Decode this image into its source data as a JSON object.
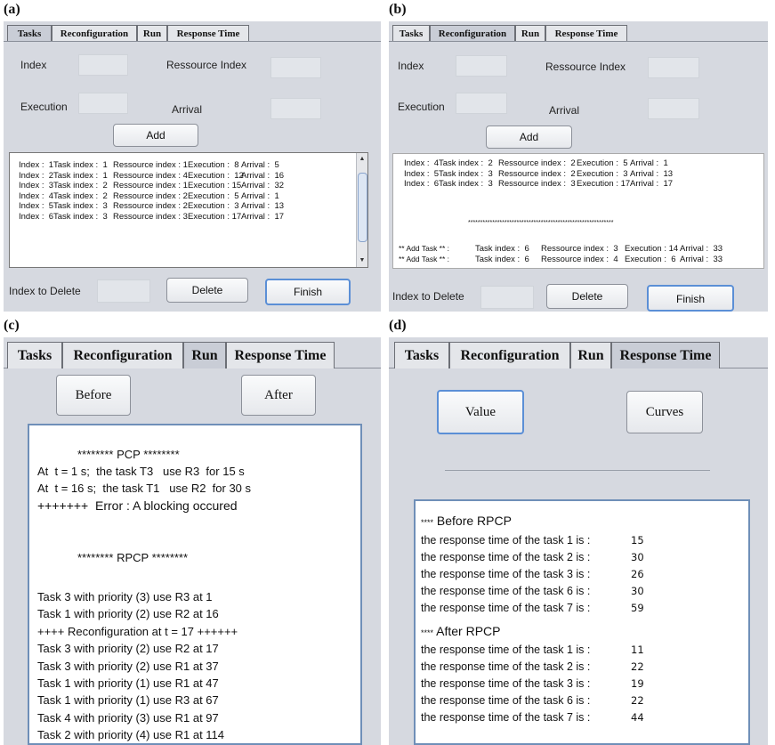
{
  "labels": {
    "a": "(a)",
    "b": "(b)",
    "c": "(c)",
    "d": "(d)"
  },
  "tabs": [
    "Tasks",
    "Reconfiguration",
    "Run",
    "Response Time"
  ],
  "form": {
    "index": "Index",
    "resource_index": "Ressource Index",
    "execution": "Execution",
    "arrival": "Arrival",
    "add": "Add",
    "index_to_delete": "Index to Delete",
    "delete": "Delete",
    "finish": "Finish"
  },
  "panel_a": {
    "rows": [
      {
        "index": "Index :  1",
        "task": "Task index :  1",
        "res": "Ressource index : 1",
        "exec": "Execution :  8",
        "arr": "Arrival :  5"
      },
      {
        "index": "Index :  2",
        "task": "Task index :  1",
        "res": "Ressource index : 4",
        "exec": "Execution :  12",
        "arr": "Arrival :  16"
      },
      {
        "index": "Index :  3",
        "task": "Task index :  2",
        "res": "Ressource index : 1",
        "exec": "Execution : 15",
        "arr": "Arrival :  32"
      },
      {
        "index": "Index :  4",
        "task": "Task index :  2",
        "res": "Ressource index : 2",
        "exec": "Execution :  5",
        "arr": "Arrival :  1"
      },
      {
        "index": "Index :  5",
        "task": "Task index :  3",
        "res": "Ressource index : 2",
        "exec": "Execution :  3",
        "arr": "Arrival :  13"
      },
      {
        "index": "Index :  6",
        "task": "Task index :  3",
        "res": "Ressource index : 3",
        "exec": "Execution : 17",
        "arr": "Arrival :  17"
      }
    ]
  },
  "panel_b": {
    "rows": [
      {
        "index": "Index :  4",
        "task": "Task index :  2",
        "res": "Ressource index :  2",
        "exec": "Execution :  5",
        "arr": "Arrival :  1"
      },
      {
        "index": "Index :  5",
        "task": "Task index :  3",
        "res": "Ressource index :  2",
        "exec": "Execution :  3",
        "arr": "Arrival :  13"
      },
      {
        "index": "Index :  6",
        "task": "Task index :  3",
        "res": "Ressource index :  3",
        "exec": "Execution : 17",
        "arr": "Arrival :  17"
      }
    ],
    "stars": "************************************************************",
    "added": [
      {
        "prefix": "** Add Task ** :",
        "task": "Task index :  6",
        "res": "Ressource index :  3",
        "exec": "Execution : 14",
        "arr": "Arrival :  33"
      },
      {
        "prefix": "** Add Task ** :",
        "task": "Task index :  6",
        "res": "Ressource index :  4",
        "exec": "Execution :  6",
        "arr": "Arrival :  33"
      }
    ]
  },
  "panel_c": {
    "before": "Before",
    "after": "After",
    "pcp_header": "******** PCP ********",
    "pcp_lines": [
      "At  t = 1 s;  the task T3   use R3  for 15 s",
      "At  t = 16 s;  the task T1   use R2  for 30 s"
    ],
    "error": "+++++++  Error : A blocking occured",
    "rpcp_header": "******** RPCP ********",
    "rpcp_lines": [
      "Task 3 with priority (3) use R3 at 1",
      "Task 1 with priority (2) use R2 at 16",
      "++++ Reconfiguration at t = 17 ++++++",
      "Task 3 with priority (2) use R2 at 17",
      "Task 3 with priority (2) use R1 at 37",
      "Task 1 with priority (1) use R1 at 47",
      "Task 1 with priority (1) use R3 at 67",
      "Task 4 with priority (3) use R1 at 97",
      "Task 2 with priority (4) use R1 at 114"
    ]
  },
  "panel_d": {
    "value": "Value",
    "curves": "Curves",
    "before_header": "Before RPCP",
    "after_header": "After RPCP",
    "stars": "****",
    "before_lines": [
      {
        "text": "the response time of the task 1 is :",
        "val": "15"
      },
      {
        "text": "the response time of the task 2 is :",
        "val": "30"
      },
      {
        "text": "the response time of the task 3 is :",
        "val": "26"
      },
      {
        "text": "the response time of the task 6 is :",
        "val": "30"
      },
      {
        "text": "the response time of the task 7 is :",
        "val": "59"
      }
    ],
    "after_lines": [
      {
        "text": "the response time of the task 1 is :",
        "val": "11"
      },
      {
        "text": "the response time of the task 2 is :",
        "val": "22"
      },
      {
        "text": "the response time of the task 3 is :",
        "val": "19"
      },
      {
        "text": "the response time of the task 6 is :",
        "val": "22"
      },
      {
        "text": "the response time of the task 7 is :",
        "val": "44"
      }
    ]
  }
}
